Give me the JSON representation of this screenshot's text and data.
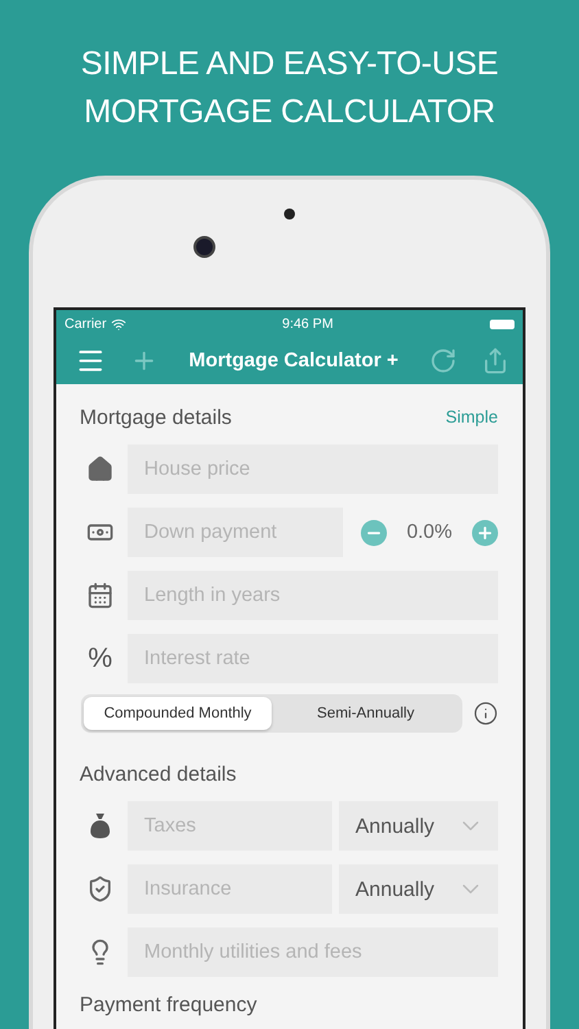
{
  "headline": [
    "SIMPLE AND EASY-TO-USE",
    "MORTGAGE CALCULATOR"
  ],
  "status_bar": {
    "carrier": "Carrier",
    "time": "9:46 PM"
  },
  "nav": {
    "title": "Mortgage Calculator +"
  },
  "mortgage_section": {
    "title": "Mortgage details",
    "action": "Simple"
  },
  "mortgage_fields": [
    {
      "kind": "input",
      "placeholder": "House price"
    },
    {
      "kind": "stepper",
      "placeholder": "Down payment",
      "value": "0.0%"
    },
    {
      "kind": "input",
      "placeholder": "Length in years"
    },
    {
      "kind": "input",
      "icon_text": "%",
      "placeholder": "Interest rate"
    }
  ],
  "compounding": [
    {
      "label": "Compounded Monthly",
      "selected": true
    },
    {
      "label": "Semi-Annually",
      "selected": false
    }
  ],
  "advanced_section": {
    "title": "Advanced details"
  },
  "advanced_fields": [
    {
      "kind": "select",
      "placeholder": "Taxes",
      "value": "Annually"
    },
    {
      "kind": "select",
      "placeholder": "Insurance",
      "value": "Annually"
    },
    {
      "kind": "input",
      "placeholder": "Monthly utilities and fees"
    }
  ],
  "payment_section": {
    "title": "Payment frequency"
  }
}
